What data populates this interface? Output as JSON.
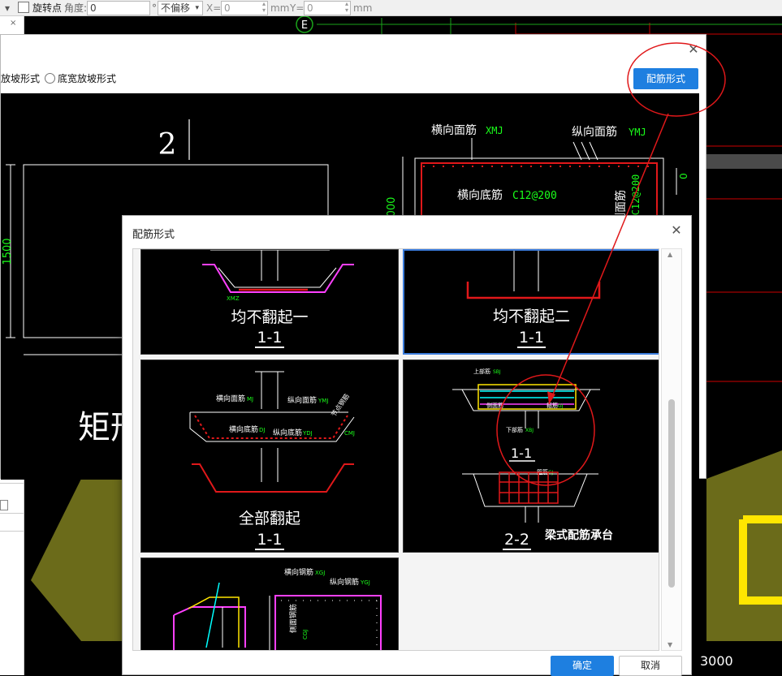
{
  "toolbar": {
    "rotate_label": "旋转点",
    "angle_label": "角度:",
    "angle_value": "0",
    "degree_unit": "°",
    "offset_value": "不偏移",
    "x_label": "X=",
    "x_value": "0",
    "mm1": "mm",
    "y_label": "Y=",
    "y_value": "0",
    "mm2": "mm"
  },
  "background": {
    "axis_marker": "E",
    "dim_3000": "3000"
  },
  "dialog1": {
    "radio1_label": "放坡形式",
    "radio2_label": "底宽放坡形式",
    "form_button": "配筋形式",
    "preview": {
      "num": "2",
      "dim_1500": "1500",
      "dim_000": "000",
      "big_text": "矩形",
      "h_top": "横向面筋",
      "h_top_code": "XMJ",
      "v_top": "纵向面筋",
      "v_top_code": "YMJ",
      "h_bot": "横向底筋",
      "h_bot_code": "C12@200",
      "side": "侧面筋",
      "side_code": "C12@200"
    }
  },
  "dialog2": {
    "title": "配筋形式",
    "ok": "确定",
    "cancel": "取消",
    "tiles": [
      {
        "label": "均不翻起一",
        "sub": "1-1"
      },
      {
        "label": "均不翻起二",
        "sub": "1-1"
      },
      {
        "label": "全部翻起",
        "sub": "1-1"
      },
      {
        "label": "",
        "sub": "2-2",
        "extra": "梁式配筋承台"
      },
      {
        "label": "",
        "sub": ""
      }
    ],
    "t3": {
      "h_top": "横向面筋",
      "h_top_code": "MJ",
      "v_top": "纵向面筋",
      "v_top_code": "YMJ",
      "h_bot": "横向底筋",
      "h_bot_code": "DJ",
      "v_bot": "纵向底筋",
      "v_bot_code": "YDJ",
      "ang": "节点钢筋",
      "cmj": "CMJ"
    },
    "t4": {
      "top": "上部筋",
      "top_code": "SBJ",
      "stir": "箍筋",
      "stir_code": "GJ",
      "side": "侧面筋",
      "bot": "下部筋",
      "bot_code": "XBJ",
      "sec": "1-1"
    },
    "t5": {
      "h": "横向钢筋",
      "h_code": "XGJ",
      "v": "纵向钢筋",
      "v_code": "YGJ",
      "stirrup": "侧面钢筋",
      "stir_code": "CGJ"
    }
  }
}
